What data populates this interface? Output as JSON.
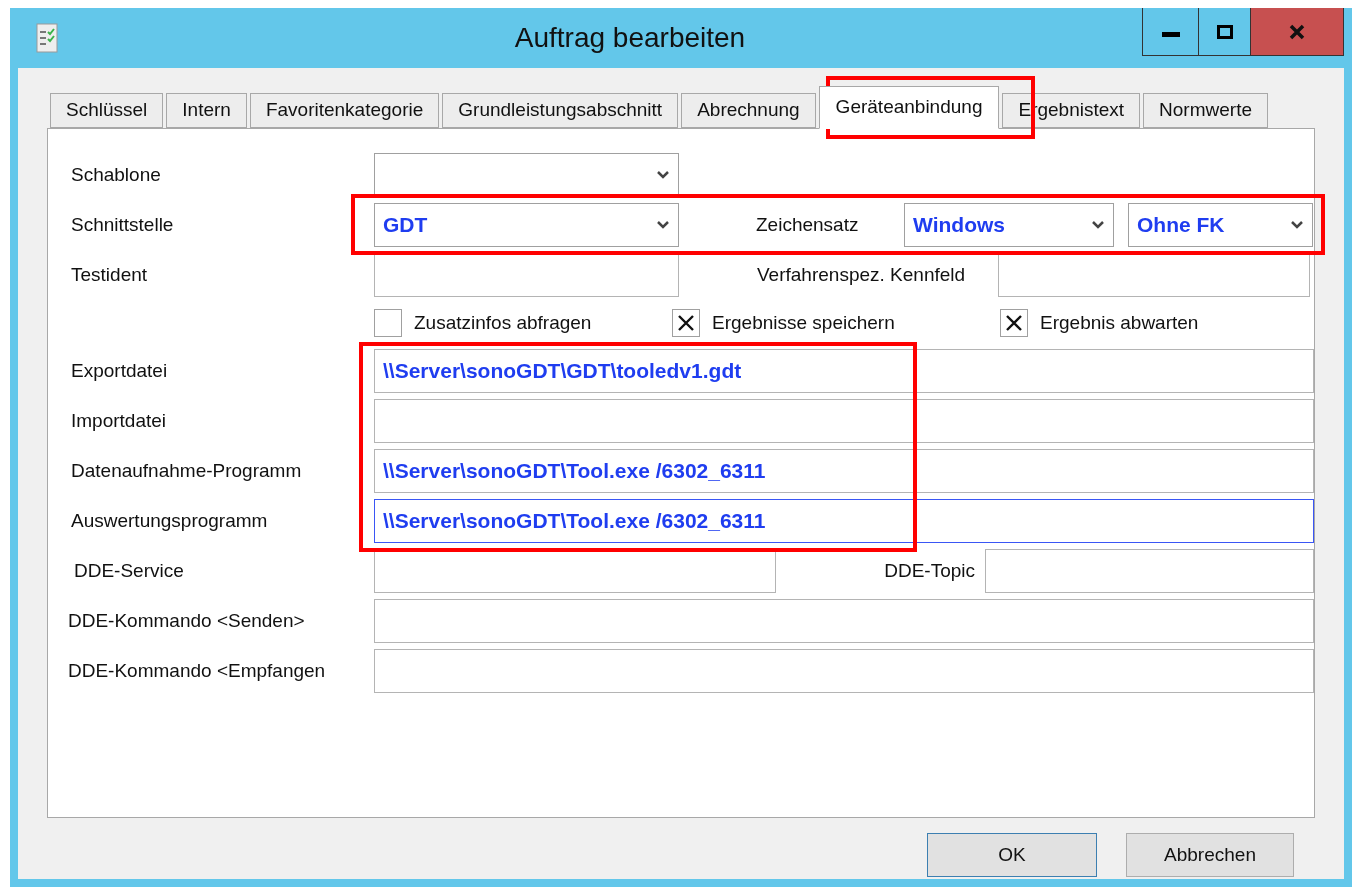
{
  "window": {
    "title": "Auftrag bearbeiten"
  },
  "tabs": [
    {
      "label": "Schlüssel",
      "selected": false
    },
    {
      "label": "Intern",
      "selected": false
    },
    {
      "label": "Favoritenkategorie",
      "selected": false
    },
    {
      "label": "Grundleistungsabschnitt",
      "selected": false
    },
    {
      "label": "Abrechnung",
      "selected": false
    },
    {
      "label": "Geräteanbindung",
      "selected": true
    },
    {
      "label": "Ergebnistext",
      "selected": false
    },
    {
      "label": "Normwerte",
      "selected": false
    }
  ],
  "rows": [
    {
      "kind": "combo",
      "label": "Schablone"
    },
    {
      "kind": "combo-charset",
      "label": "Schnittstelle",
      "value": "GDT",
      "charset_label": "Zeichensatz",
      "charset": "Windows",
      "variant": "Ohne FK"
    },
    {
      "kind": "text-pair",
      "label": "Testident",
      "label2": "Verfahrenspez. Kennfeld"
    },
    {
      "kind": "checks",
      "checks": [
        {
          "label": "Zusatzinfos abfragen",
          "checked": false
        },
        {
          "label": "Ergebnisse speichern",
          "checked": true
        },
        {
          "label": "Ergebnis abwarten",
          "checked": true
        }
      ]
    },
    {
      "kind": "path",
      "label": "Exportdatei",
      "value": "\\\\Server\\sonoGDT\\GDT\\tooledv1.gdt",
      "focused": false
    },
    {
      "kind": "path",
      "label": "Importdatei",
      "focused": false
    },
    {
      "kind": "path",
      "label": "Datenaufnahme-Programm",
      "value": "\\\\Server\\sonoGDT\\Tool.exe /6302_6311",
      "focused": false
    },
    {
      "kind": "path",
      "label": "Auswertungsprogramm",
      "value": "\\\\Server\\sonoGDT\\Tool.exe /6302_6311",
      "focused": true
    },
    {
      "kind": "dde-pair",
      "label": "DDE-Service",
      "label2": "DDE-Topic"
    },
    {
      "kind": "path",
      "label": "DDE-Kommando <Senden>",
      "focused": false
    },
    {
      "kind": "path",
      "label": "DDE-Kommando <Empfangen",
      "focused": false
    }
  ],
  "buttons": [
    {
      "label": "OK",
      "default": true
    },
    {
      "label": "Abbrechen",
      "default": false
    }
  ]
}
